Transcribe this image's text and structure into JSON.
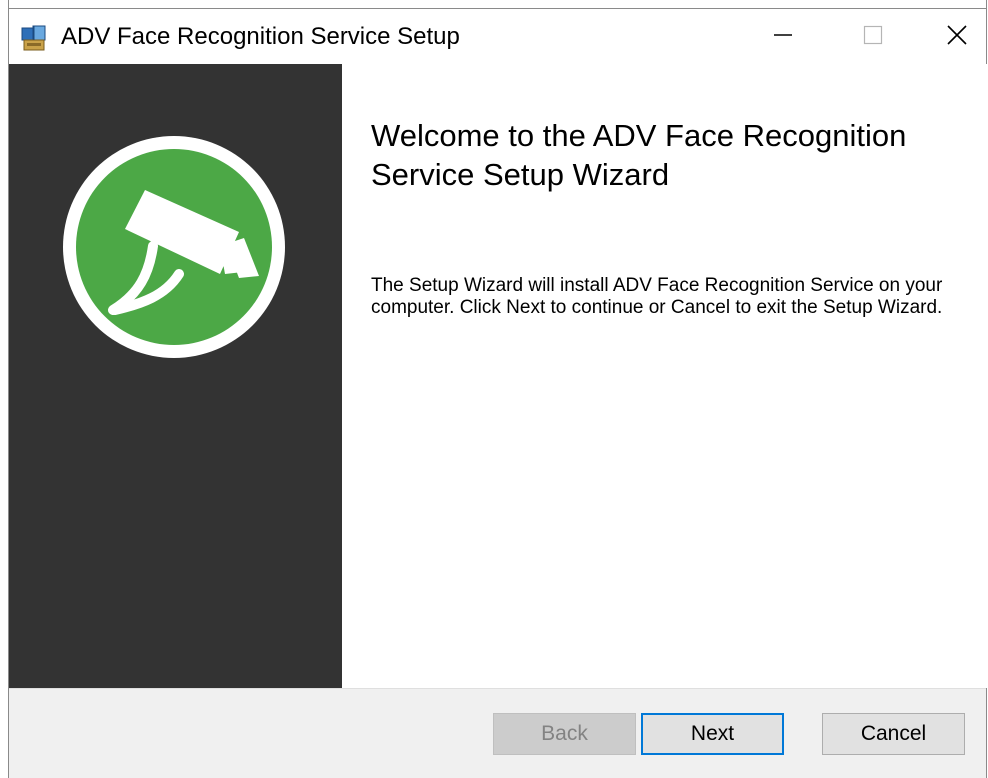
{
  "window": {
    "title": "ADV Face Recognition Service Setup"
  },
  "icons": {
    "app": "installer-package-icon",
    "minimize": "minimize-icon",
    "maximize": "maximize-icon",
    "close": "close-icon",
    "banner": "security-camera-icon"
  },
  "colors": {
    "banner_bg": "#333333",
    "logo_green": "#4ca846",
    "accent_focus": "#0078d7"
  },
  "content": {
    "heading": "Welcome to the ADV Face Recognition Service Setup Wizard",
    "body": "The Setup Wizard will install ADV Face Recognition Service on your computer. Click Next to continue or Cancel to exit the Setup Wizard."
  },
  "buttons": {
    "back": "Back",
    "next": "Next",
    "cancel": "Cancel"
  }
}
